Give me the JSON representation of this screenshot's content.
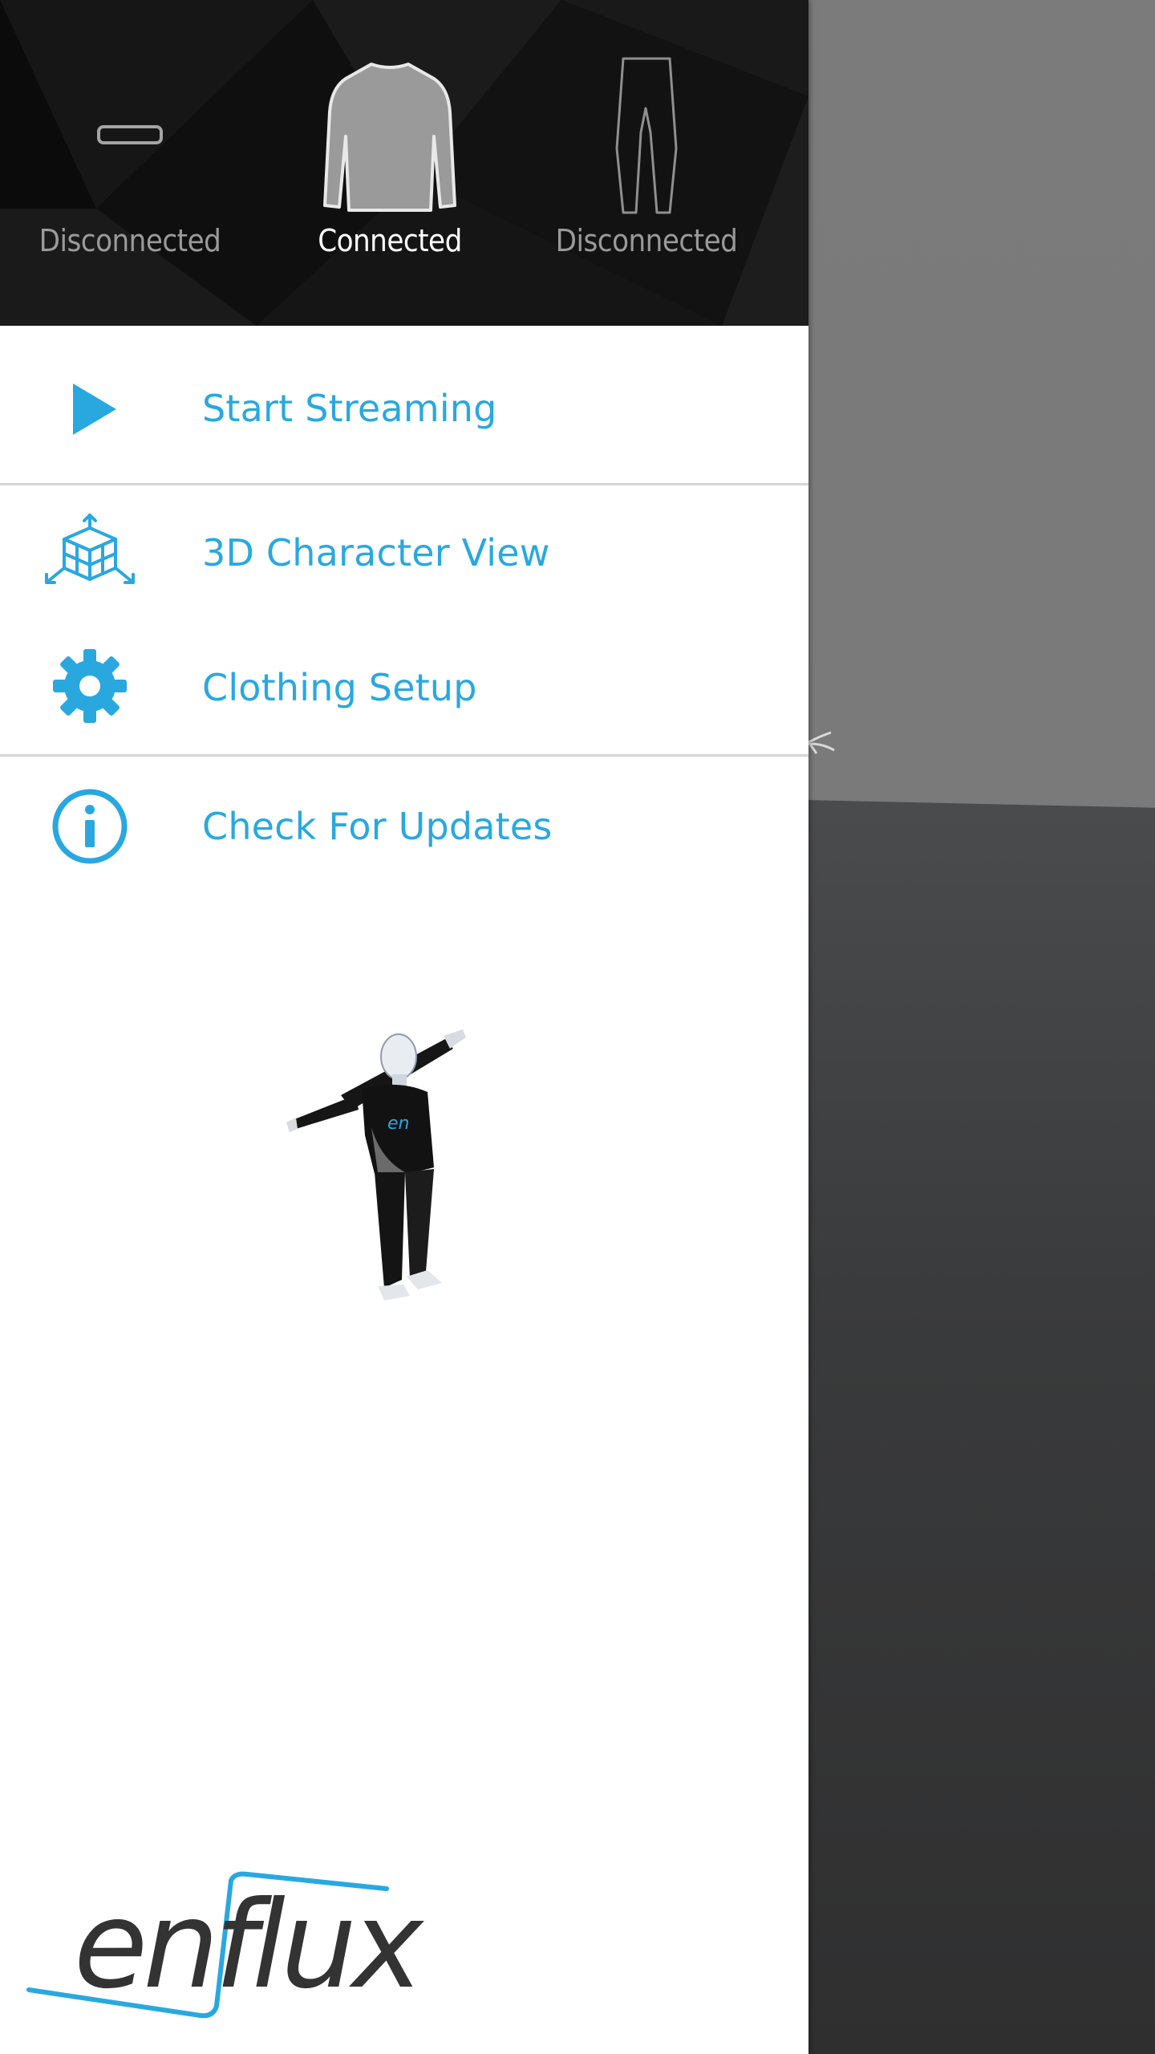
{
  "header": {
    "garments": [
      {
        "name": "belt",
        "status": "Disconnected",
        "connected": false
      },
      {
        "name": "shirt",
        "status": "Connected",
        "connected": true
      },
      {
        "name": "pants",
        "status": "Disconnected",
        "connected": false
      }
    ]
  },
  "menu": {
    "items": [
      {
        "label": "Start Streaming",
        "icon": "play-icon"
      },
      {
        "label": "3D Character View",
        "icon": "cube-axes-icon"
      },
      {
        "label": "Clothing Setup",
        "icon": "gear-icon"
      },
      {
        "label": "Check For Updates",
        "icon": "info-icon"
      }
    ]
  },
  "logo": {
    "text": "enflux"
  },
  "colors": {
    "accent": "#29a8e0",
    "header_bg": "#0b0b0b",
    "disconnected_text": "#9a9a9a",
    "connected_text": "#ffffff",
    "logo_dark": "#333333"
  }
}
